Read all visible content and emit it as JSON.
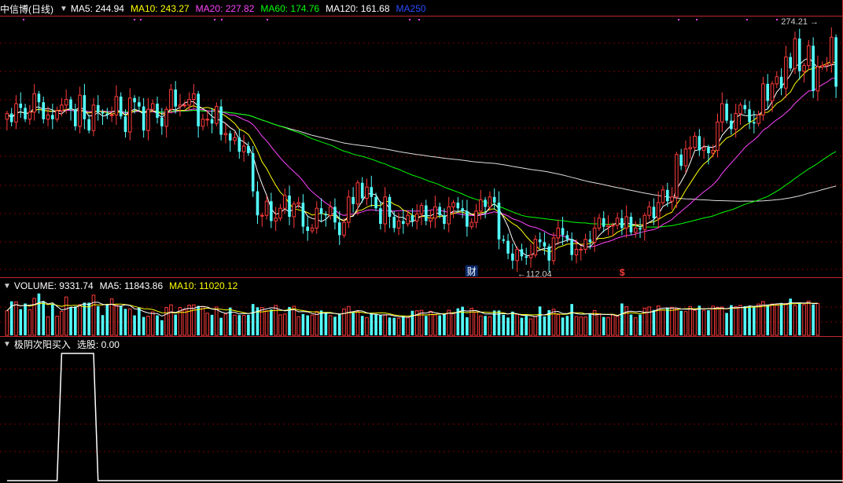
{
  "main": {
    "title": "中信博(日线)",
    "indicators": [
      {
        "label": "MA5: 244.94",
        "color": "#ffffff"
      },
      {
        "label": "MA10: 243.27",
        "color": "#ffff00"
      },
      {
        "label": "MA20: 227.82",
        "color": "#ff44ff"
      },
      {
        "label": "MA60: 174.76",
        "color": "#00ff00"
      },
      {
        "label": "MA120: 161.68",
        "color": "#ffffff"
      },
      {
        "label": "MA250",
        "color": "#2b4bff"
      }
    ],
    "high_label": "274.21",
    "low_label": "112.04",
    "marker_cai": "财",
    "marker_dollar": "$"
  },
  "volume": {
    "title": "VOLUME: 9331.74",
    "ma5": "MA5: 11843.86",
    "ma10": "MA10: 11020.12"
  },
  "signal": {
    "title": "极阴次阳买入",
    "value": "选股: 0.00"
  },
  "colors": {
    "up": "#ff3b3b",
    "down": "#54ffff",
    "grid": "#7a0000",
    "divider": "#c0282c",
    "ma5": "#ffffff",
    "ma10": "#ffff00",
    "ma20": "#ff44ff",
    "ma60": "#00ff00",
    "ma120": "#dddddd"
  },
  "chart_data": [
    {
      "type": "candlestick",
      "series_name": "中信博(日线)",
      "close": [
        218,
        212,
        225,
        222,
        214,
        219,
        232,
        226,
        214,
        217,
        214,
        220,
        224,
        228,
        221,
        209,
        231,
        214,
        206,
        224,
        219,
        218,
        217,
        217,
        230,
        216,
        205,
        229,
        226,
        223,
        206,
        221,
        225,
        215,
        209,
        221,
        235,
        223,
        224,
        224,
        228,
        232,
        209,
        214,
        214,
        211,
        223,
        203,
        204,
        199,
        201,
        191,
        195,
        190,
        163,
        146,
        146,
        156,
        142,
        144,
        151,
        160,
        145,
        154,
        155,
        138,
        135,
        137,
        151,
        147,
        146,
        152,
        141,
        132,
        141,
        159,
        154,
        169,
        158,
        166,
        159,
        151,
        140,
        159,
        145,
        137,
        142,
        140,
        146,
        142,
        147,
        153,
        142,
        144,
        152,
        146,
        140,
        152,
        155,
        151,
        149,
        138,
        141,
        149,
        157,
        152,
        159,
        155,
        129,
        128,
        119,
        114,
        122,
        117,
        116,
        118,
        129,
        127,
        124,
        114,
        130,
        137,
        132,
        129,
        118,
        122,
        122,
        129,
        127,
        137,
        144,
        138,
        139,
        139,
        144,
        137,
        145,
        134,
        137,
        136,
        146,
        152,
        144,
        155,
        164,
        156,
        159,
        189,
        181,
        193,
        194,
        202,
        192,
        194,
        190,
        192,
        212,
        225,
        213,
        207,
        218,
        224,
        221,
        212,
        211,
        217,
        239,
        227,
        239,
        244,
        236,
        258,
        250,
        271,
        248,
        252,
        266,
        234,
        251,
        252,
        253,
        272,
        237
      ],
      "x_labels": [],
      "ylim": [
        105,
        285
      ]
    },
    {
      "type": "bar",
      "series_name": "VOLUME",
      "values": [
        9.1,
        12.6,
        12.4,
        9.7,
        11.8,
        9.5,
        13.7,
        15.5,
        12.6,
        6.9,
        11.6,
        7.1,
        8.9,
        14.2,
        10.4,
        10.7,
        11.4,
        12.1,
        12.1,
        14.9,
        10.8,
        7.5,
        11.2,
        13.5,
        11.4,
        10.8,
        9.8,
        9.8,
        7.4,
        10.4,
        6.8,
        7.1,
        8.7,
        7.4,
        5.6,
        10.3,
        11.3,
        7.7,
        10.3,
        9.4,
        11.2,
        11.3,
        10.9,
        10.7,
        8.2,
        7.6,
        10.5,
        6.5,
        7.9,
        10.3,
        7.5,
        7.5,
        7.4,
        7.6,
        11.6,
        10.4,
        10.3,
        9.1,
        9.6,
        11.1,
        7.6,
        7.9,
        10.5,
        10.8,
        6.9,
        7.9,
        7.4,
        7.5,
        8.8,
        9.2,
        8.4,
        7.3,
        6.9,
        7.9,
        9.8,
        10.7,
        8.6,
        8.8,
        7.2,
        6.6,
        8.3,
        7.9,
        7.6,
        7.5,
        6.6,
        6.5,
        6.3,
        7.3,
        6.6,
        9.1,
        9.1,
        9.3,
        7.2,
        8.9,
        7.6,
        7.4,
        7.9,
        9.3,
        8.3,
        10.0,
        10.6,
        6.7,
        10.0,
        8.6,
        7.2,
        7.2,
        6.9,
        9.2,
        9.2,
        7.6,
        6.6,
        8.8,
        7.8,
        6.5,
        7.2,
        6.1,
        7.0,
        10.7,
        7.0,
        9.3,
        9.7,
        7.7,
        6.6,
        7.2,
        11.6,
        7.0,
        6.8,
        6.8,
        8.0,
        9.2,
        8.0,
        6.8,
        6.6,
        7.6,
        7.1,
        11.8,
        10.6,
        7.7,
        6.5,
        7.7,
        10.1,
        10.5,
        9.4,
        10.9,
        9.4,
        10.3,
        10.4,
        9.7,
        9.1,
        8.8,
        10.7,
        9.3,
        11.0,
        9.3,
        9.3,
        10.8,
        10.4,
        10.5,
        8.3,
        11.2,
        10.6,
        11.1,
        10.8,
        10.8,
        10.3,
        11.6,
        12.5,
        11.3,
        11.6,
        11.4,
        12.0,
        11.8,
        13.6,
        11.1,
        11.9,
        11.4,
        12.7,
        11.4,
        11.8
      ],
      "ylim": [
        0,
        16
      ]
    },
    {
      "type": "line",
      "series_name": "极阴次阳买入",
      "values": [
        0,
        0,
        0,
        0,
        0,
        0,
        0,
        0,
        0,
        0,
        0,
        0,
        1,
        1,
        1,
        1,
        1,
        1,
        1,
        1,
        0,
        0,
        0,
        0,
        0,
        0,
        0,
        0,
        0,
        0,
        0,
        0,
        0,
        0,
        0,
        0,
        0,
        0,
        0,
        0,
        0,
        0,
        0,
        0,
        0,
        0,
        0,
        0,
        0,
        0,
        0,
        0,
        0,
        0,
        0,
        0,
        0,
        0,
        0,
        0,
        0,
        0,
        0,
        0,
        0,
        0,
        0,
        0,
        0,
        0,
        0,
        0,
        0,
        0,
        0,
        0,
        0,
        0,
        0,
        0,
        0,
        0,
        0,
        0,
        0,
        0,
        0,
        0,
        0,
        0,
        0,
        0,
        0,
        0,
        0,
        0,
        0,
        0,
        0,
        0,
        0,
        0,
        0,
        0,
        0,
        0,
        0,
        0,
        0,
        0,
        0,
        0,
        0,
        0,
        0,
        0,
        0,
        0,
        0,
        0,
        0,
        0,
        0,
        0,
        0,
        0,
        0,
        0,
        0,
        0,
        0,
        0,
        0,
        0,
        0,
        0,
        0,
        0,
        0,
        0,
        0,
        0,
        0,
        0,
        0,
        0,
        0,
        0,
        0,
        0,
        0,
        0,
        0,
        0,
        0,
        0,
        0,
        0,
        0,
        0,
        0,
        0,
        0,
        0,
        0,
        0,
        0,
        0,
        0,
        0,
        0,
        0,
        0,
        0,
        0,
        0,
        0,
        0,
        0,
        0,
        0,
        0,
        0,
        0,
        0
      ],
      "ylim": [
        0,
        1
      ]
    }
  ]
}
